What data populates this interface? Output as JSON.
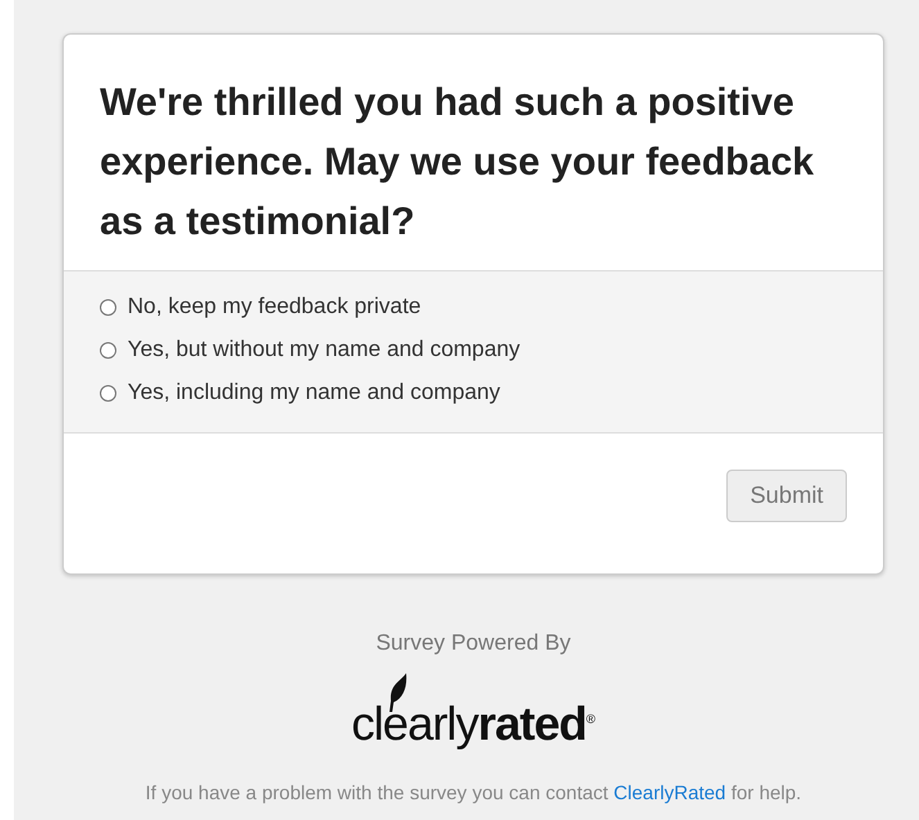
{
  "question": "We're thrilled you had such a positive experience. May we use your feedback as a testimonial?",
  "options": [
    {
      "label": "No, keep my feedback private",
      "selected": false
    },
    {
      "label": "Yes, but without my name and company",
      "selected": false
    },
    {
      "label": "Yes, including my name and company",
      "selected": false
    }
  ],
  "submit": {
    "label": "Submit",
    "disabled": true
  },
  "powered_by": "Survey Powered By",
  "logo": {
    "light": "clearly",
    "bold": "rated",
    "mark": "®"
  },
  "help": {
    "before": "If you have a problem with the survey you can contact ",
    "link": "ClearlyRated",
    "after": " for help."
  }
}
